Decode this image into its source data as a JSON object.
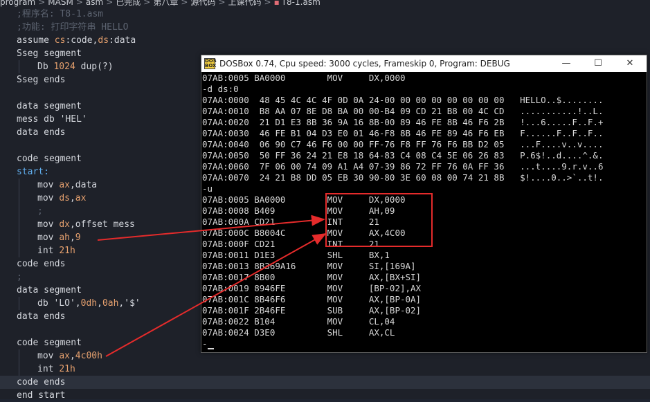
{
  "breadcrumb": {
    "parts": [
      "program",
      "MASM",
      "asm",
      "已完成",
      "第八章",
      "源代码",
      "上课代码"
    ],
    "file": "T8-1.asm"
  },
  "editor": {
    "lines": [
      {
        "indent": false,
        "tokens": [
          {
            "t": ";程序名: T8-1.asm",
            "c": "com"
          }
        ]
      },
      {
        "indent": false,
        "tokens": [
          {
            "t": ";功能: 打印字符串 HELLO",
            "c": "com"
          }
        ]
      },
      {
        "indent": false,
        "tokens": [
          {
            "t": "assume ",
            "c": "pl"
          },
          {
            "t": "cs",
            "c": "reg"
          },
          {
            "t": ":code,",
            "c": "pl"
          },
          {
            "t": "ds",
            "c": "reg"
          },
          {
            "t": ":data",
            "c": "pl"
          }
        ]
      },
      {
        "indent": false,
        "tokens": [
          {
            "t": "Sseg segment",
            "c": "pl"
          }
        ]
      },
      {
        "indent": true,
        "tokens": [
          {
            "t": "Db ",
            "c": "pl"
          },
          {
            "t": "1024",
            "c": "num"
          },
          {
            "t": " dup(?)",
            "c": "pl"
          }
        ]
      },
      {
        "indent": false,
        "tokens": [
          {
            "t": "Sseg ends",
            "c": "pl"
          }
        ]
      },
      {
        "indent": false,
        "tokens": [
          {
            "t": "",
            "c": "pl"
          }
        ]
      },
      {
        "indent": false,
        "tokens": [
          {
            "t": "data segment",
            "c": "pl"
          }
        ]
      },
      {
        "indent": false,
        "tokens": [
          {
            "t": "mess db ",
            "c": "pl"
          },
          {
            "t": "'HEL'",
            "c": "str"
          }
        ]
      },
      {
        "indent": false,
        "tokens": [
          {
            "t": "data ends",
            "c": "pl"
          }
        ]
      },
      {
        "indent": false,
        "tokens": [
          {
            "t": "",
            "c": "pl"
          }
        ]
      },
      {
        "indent": false,
        "tokens": [
          {
            "t": "code segment",
            "c": "pl"
          }
        ]
      },
      {
        "indent": false,
        "tokens": [
          {
            "t": "start:",
            "c": "lbl"
          }
        ]
      },
      {
        "indent": true,
        "tokens": [
          {
            "t": "mov ",
            "c": "pl"
          },
          {
            "t": "ax",
            "c": "reg"
          },
          {
            "t": ",data",
            "c": "pl"
          }
        ]
      },
      {
        "indent": true,
        "tokens": [
          {
            "t": "mov ",
            "c": "pl"
          },
          {
            "t": "ds",
            "c": "reg"
          },
          {
            "t": ",",
            "c": "pl"
          },
          {
            "t": "ax",
            "c": "reg"
          }
        ]
      },
      {
        "indent": true,
        "tokens": [
          {
            "t": ";",
            "c": "com"
          }
        ]
      },
      {
        "indent": true,
        "tokens": [
          {
            "t": "mov ",
            "c": "pl"
          },
          {
            "t": "dx",
            "c": "reg"
          },
          {
            "t": ",offset mess",
            "c": "pl"
          }
        ]
      },
      {
        "indent": true,
        "tokens": [
          {
            "t": "mov ",
            "c": "pl"
          },
          {
            "t": "ah",
            "c": "reg"
          },
          {
            "t": ",",
            "c": "pl"
          },
          {
            "t": "9",
            "c": "num"
          }
        ]
      },
      {
        "indent": true,
        "tokens": [
          {
            "t": "int ",
            "c": "pl"
          },
          {
            "t": "21h",
            "c": "num"
          }
        ]
      },
      {
        "indent": false,
        "tokens": [
          {
            "t": "code ends",
            "c": "pl"
          }
        ]
      },
      {
        "indent": false,
        "tokens": [
          {
            "t": ";",
            "c": "com"
          }
        ]
      },
      {
        "indent": false,
        "tokens": [
          {
            "t": "data segment",
            "c": "pl"
          }
        ]
      },
      {
        "indent": true,
        "tokens": [
          {
            "t": "db ",
            "c": "pl"
          },
          {
            "t": "'LO'",
            "c": "str"
          },
          {
            "t": ",",
            "c": "pl"
          },
          {
            "t": "0dh",
            "c": "num"
          },
          {
            "t": ",",
            "c": "pl"
          },
          {
            "t": "0ah",
            "c": "num"
          },
          {
            "t": ",",
            "c": "pl"
          },
          {
            "t": "'$'",
            "c": "str"
          }
        ]
      },
      {
        "indent": false,
        "tokens": [
          {
            "t": "data ends",
            "c": "pl"
          }
        ]
      },
      {
        "indent": false,
        "tokens": [
          {
            "t": "",
            "c": "pl"
          }
        ]
      },
      {
        "indent": false,
        "tokens": [
          {
            "t": "code segment",
            "c": "pl"
          }
        ]
      },
      {
        "indent": true,
        "tokens": [
          {
            "t": "mov ",
            "c": "pl"
          },
          {
            "t": "ax",
            "c": "reg"
          },
          {
            "t": ",",
            "c": "pl"
          },
          {
            "t": "4c00h",
            "c": "num"
          }
        ]
      },
      {
        "indent": true,
        "tokens": [
          {
            "t": "int ",
            "c": "pl"
          },
          {
            "t": "21h",
            "c": "num"
          }
        ]
      },
      {
        "indent": false,
        "hl": true,
        "tokens": [
          {
            "t": "code ends",
            "c": "pl"
          }
        ]
      },
      {
        "indent": false,
        "tokens": [
          {
            "t": "end start",
            "c": "pl"
          }
        ]
      }
    ]
  },
  "dosbox": {
    "title": "DOSBox 0.74, Cpu speed:     3000 cycles, Frameskip  0, Program:    DEBUG",
    "icon_label": "DOS BOX",
    "minimize": "—",
    "maximize": "☐",
    "close": "✕",
    "lines": [
      "07AB:0005 BA0000        MOV     DX,0000",
      "-d ds:0",
      "07AA:0000  48 45 4C 4C 4F 0D 0A 24-00 00 00 00 00 00 00 00   HELLO..$........",
      "07AA:0010  B8 AA 07 8E D8 BA 00 00-B4 09 CD 21 B8 00 4C CD   ...........!..L.",
      "07AA:0020  21 D1 E3 8B 36 9A 16 8B-00 89 46 FE 8B 46 F6 2B   !...6.....F..F.+",
      "07AA:0030  46 FE B1 04 D3 E0 01 46-F8 8B 46 FE 89 46 F6 EB   F......F..F..F..",
      "07AA:0040  06 90 C7 46 F6 00 00 FF-76 F8 FF 76 F6 BB D2 05   ...F....v..v....",
      "07AA:0050  50 FF 36 24 21 E8 18 64-83 C4 08 C4 5E 06 26 83   P.6$!..d....^.&.",
      "07AA:0060  7F 06 00 74 09 A1 A4 07-39 86 72 FF 76 0A FF 36   ...t....9.r.v..6",
      "07AA:0070  24 21 B8 DD 05 EB 30 90-80 3E 60 08 00 74 21 8B   $!....0..>`..t!.",
      "-u",
      "07AB:0005 BA0000        MOV     DX,0000",
      "07AB:0008 B409          MOV     AH,09",
      "07AB:000A CD21          INT     21",
      "07AB:000C B8004C        MOV     AX,4C00",
      "07AB:000F CD21          INT     21",
      "07AB:0011 D1E3          SHL     BX,1",
      "07AB:0013 8B369A16      MOV     SI,[169A]",
      "07AB:0017 8B00          MOV     AX,[BX+SI]",
      "07AB:0019 8946FE        MOV     [BP-02],AX",
      "07AB:001C 8B46F6        MOV     AX,[BP-0A]",
      "07AB:001F 2B46FE        SUB     AX,[BP-02]",
      "07AB:0022 B104          MOV     CL,04",
      "07AB:0024 D3E0          SHL     AX,CL",
      "-"
    ]
  },
  "annotation": {
    "color": "#e52b2b"
  }
}
